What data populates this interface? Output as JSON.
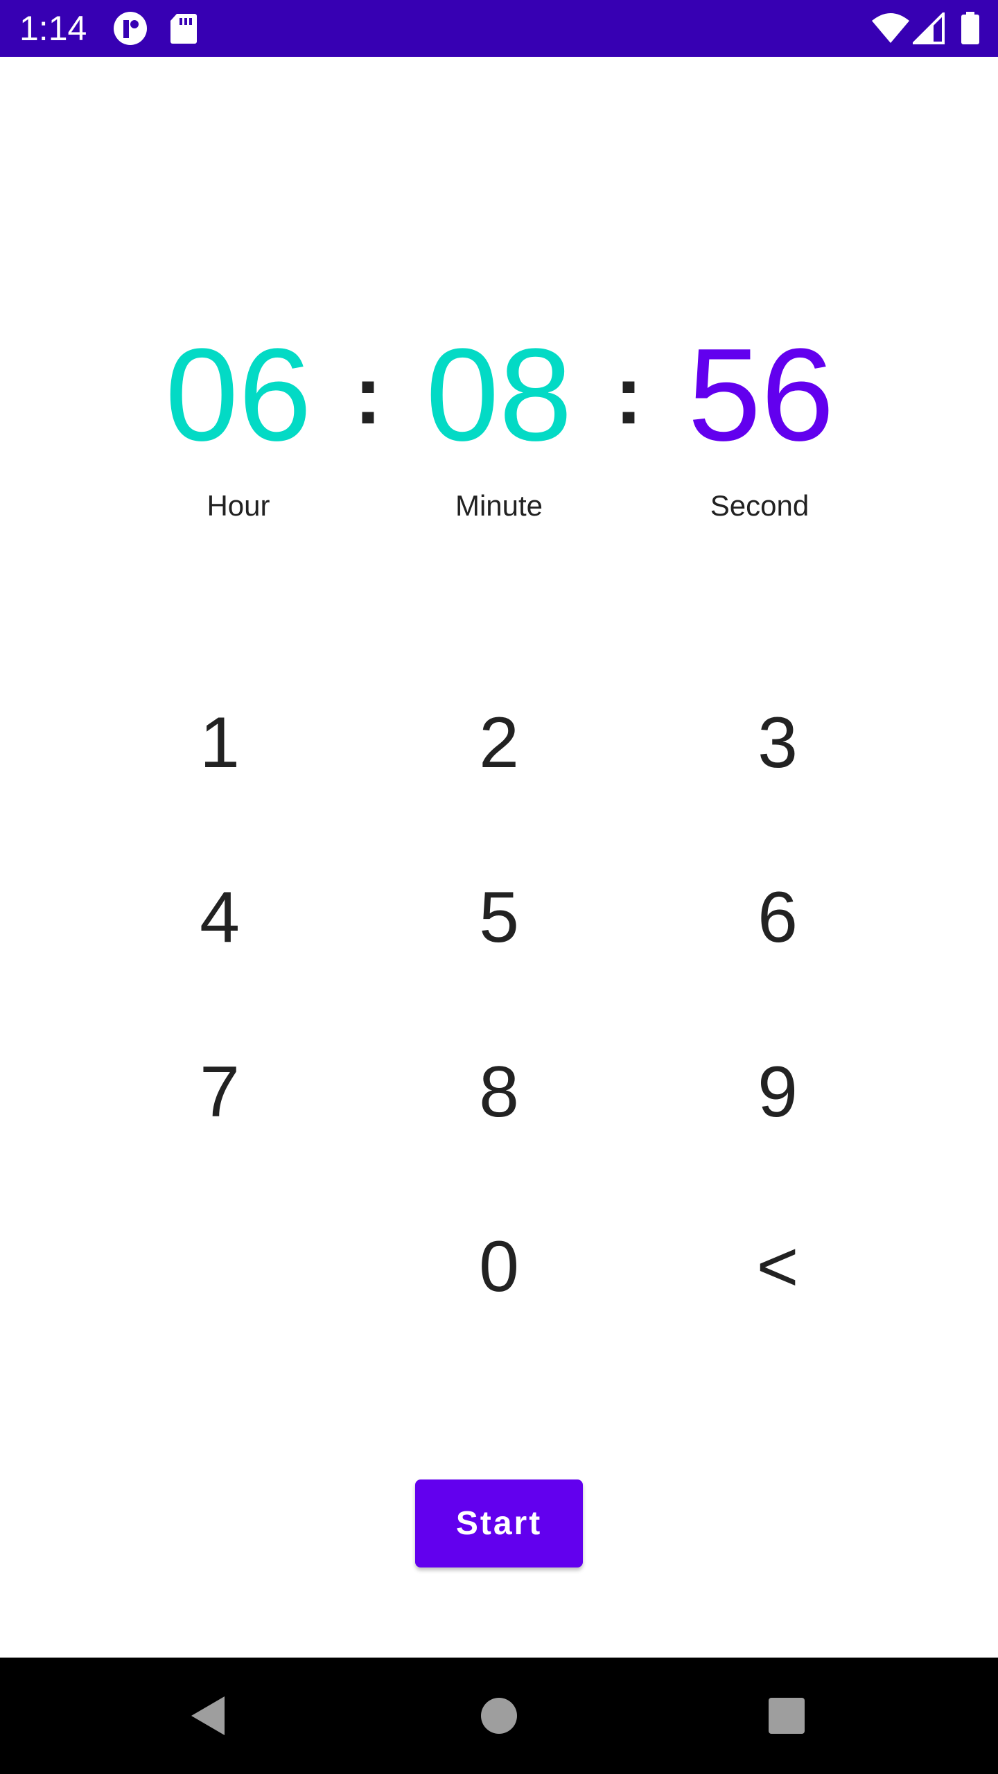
{
  "status_bar": {
    "time": "1:14",
    "background": "#3700b3",
    "icons": [
      "notification-app-icon",
      "sd-card-icon",
      "wifi-icon",
      "cell-signal-icon",
      "battery-icon"
    ]
  },
  "timer": {
    "hour": "06",
    "minute": "08",
    "second": "56",
    "separator": ":",
    "hour_label": "Hour",
    "minute_label": "Minute",
    "second_label": "Second",
    "active_color": "#6200ee",
    "inactive_color": "#03dac5"
  },
  "keypad": {
    "keys": [
      "1",
      "2",
      "3",
      "4",
      "5",
      "6",
      "7",
      "8",
      "9",
      "0",
      "<"
    ]
  },
  "start_button": {
    "label": "Start",
    "color": "#6200ee"
  },
  "nav_bar": {
    "icons": [
      "back-icon",
      "home-icon",
      "recents-icon"
    ]
  }
}
